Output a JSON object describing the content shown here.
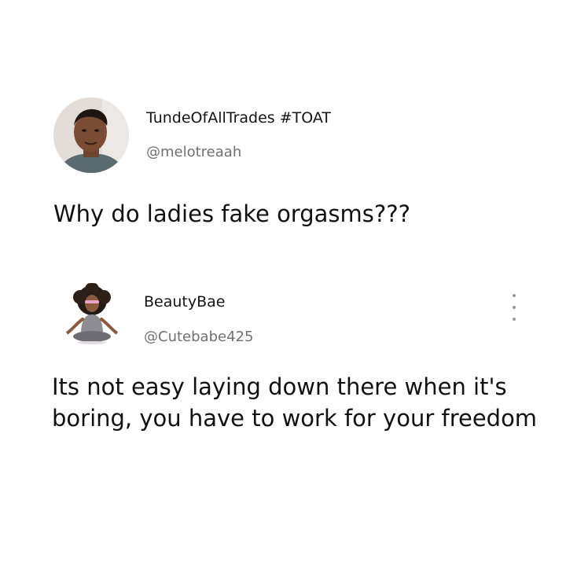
{
  "tweets": [
    {
      "display_name": "TundeOfAllTrades #TOAT",
      "handle": "@melotreaah",
      "text": "Why do ladies fake orgasms???",
      "avatar_icon": "person-photo-avatar"
    },
    {
      "display_name": "BeautyBae",
      "handle": "@Cutebabe425",
      "text": "Its not easy laying down there when it's boring, you have to work for your freedom",
      "avatar_icon": "meditating-woman-avatar",
      "menu_icon": "more-vertical-icon"
    }
  ],
  "colors": {
    "background": "#ffffff",
    "text": "#111111",
    "handle": "#707070",
    "menu_dots": "#9a9a9a"
  }
}
